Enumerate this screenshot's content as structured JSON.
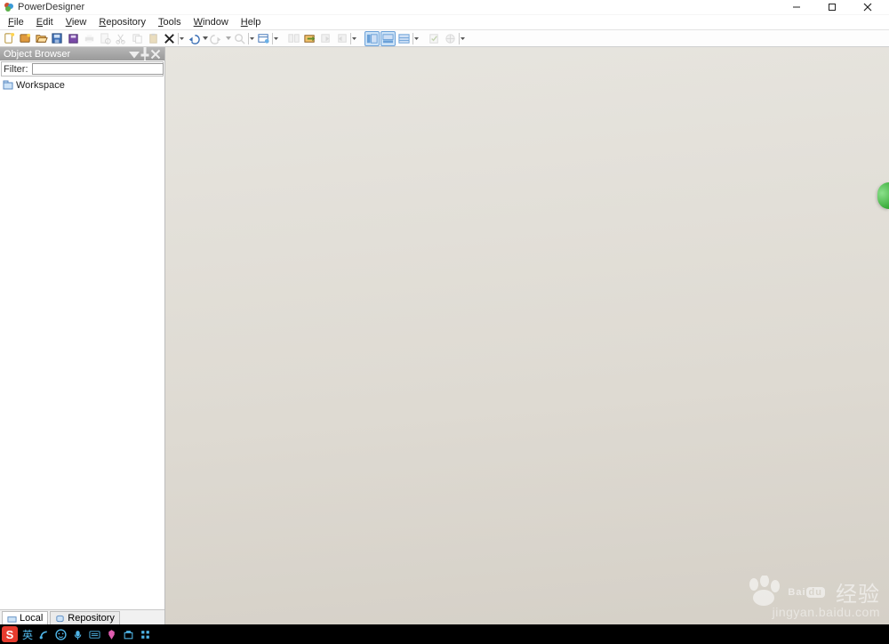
{
  "title": "PowerDesigner",
  "menus": [
    "File",
    "Edit",
    "View",
    "Repository",
    "Tools",
    "Window",
    "Help"
  ],
  "objectBrowser": {
    "title": "Object Browser",
    "filterLabel": "Filter:",
    "filterValue": "",
    "rootNode": "Workspace",
    "tabs": [
      "Local",
      "Repository"
    ]
  },
  "taskbar": {
    "ime_letter": "S",
    "lang": "英"
  },
  "watermark": {
    "brand": "Baidu",
    "cn": "经验",
    "url": "jingyan.baidu.com"
  }
}
